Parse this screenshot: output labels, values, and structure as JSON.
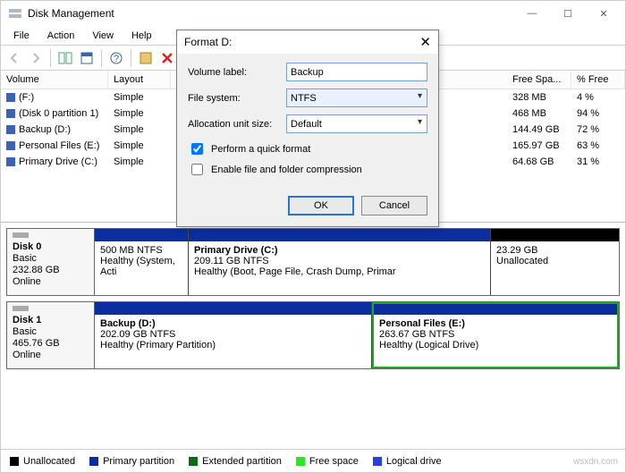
{
  "window": {
    "title": "Disk Management"
  },
  "menu": {
    "file": "File",
    "action": "Action",
    "view": "View",
    "help": "Help"
  },
  "volumes": {
    "headers": {
      "volume": "Volume",
      "layout": "Layout",
      "free": "Free Spa...",
      "pct": "% Free"
    },
    "rows": [
      {
        "name": "(F:)",
        "layout": "Simple",
        "free": "328 MB",
        "pct": "4 %"
      },
      {
        "name": "(Disk 0 partition 1)",
        "layout": "Simple",
        "free": "468 MB",
        "pct": "94 %"
      },
      {
        "name": "Backup (D:)",
        "layout": "Simple",
        "free": "144.49 GB",
        "pct": "72 %"
      },
      {
        "name": "Personal Files (E:)",
        "layout": "Simple",
        "free": "165.97 GB",
        "pct": "63 %"
      },
      {
        "name": "Primary Drive (C:)",
        "layout": "Simple",
        "free": "64.68 GB",
        "pct": "31 %"
      }
    ]
  },
  "disks": {
    "d0": {
      "name": "Disk 0",
      "type": "Basic",
      "size": "232.88 GB",
      "status": "Online",
      "p1_line1": "500 MB NTFS",
      "p1_line2": "Healthy (System, Acti",
      "p2_title": "Primary Drive  (C:)",
      "p2_line1": "209.11 GB NTFS",
      "p2_line2": "Healthy (Boot, Page File, Crash Dump, Primar",
      "p3_line1": "23.29 GB",
      "p3_line2": "Unallocated"
    },
    "d1": {
      "name": "Disk 1",
      "type": "Basic",
      "size": "465.76 GB",
      "status": "Online",
      "p1_title": "Backup  (D:)",
      "p1_line1": "202.09 GB NTFS",
      "p1_line2": "Healthy (Primary Partition)",
      "p2_title": "Personal Files  (E:)",
      "p2_line1": "263.67 GB NTFS",
      "p2_line2": "Healthy (Logical Drive)"
    }
  },
  "legend": {
    "unalloc": "Unallocated",
    "prim": "Primary partition",
    "ext": "Extended partition",
    "free": "Free space",
    "log": "Logical drive"
  },
  "dialog": {
    "title": "Format D:",
    "labels": {
      "vol": "Volume label:",
      "fs": "File system:",
      "aus": "Allocation unit size:"
    },
    "values": {
      "vol": "Backup",
      "fs": "NTFS",
      "aus": "Default"
    },
    "check1": "Perform a quick format",
    "check2": "Enable file and folder compression",
    "ok": "OK",
    "cancel": "Cancel"
  },
  "watermark": "wsxdn.com"
}
